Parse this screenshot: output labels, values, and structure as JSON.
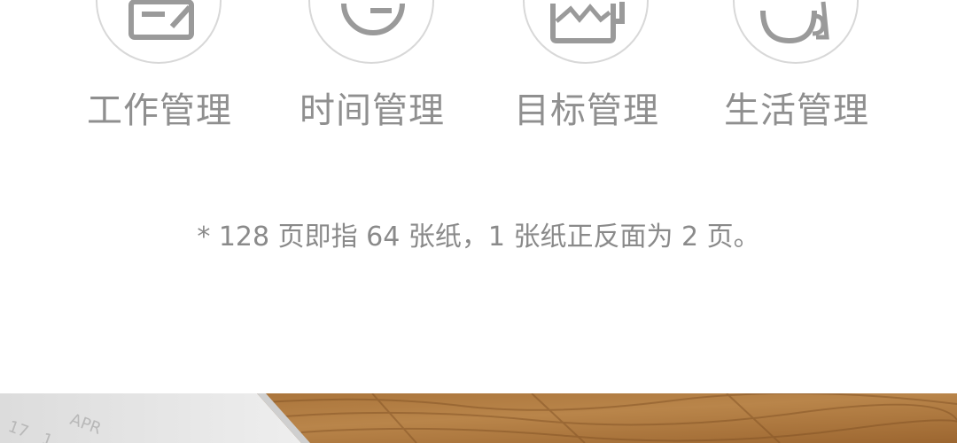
{
  "features": [
    {
      "label": "工作管理",
      "icon": "notebook-pen-icon"
    },
    {
      "label": "时间管理",
      "icon": "clock-icon"
    },
    {
      "label": "目标管理",
      "icon": "mountain-frame-icon"
    },
    {
      "label": "生活管理",
      "icon": "coffee-cup-icon"
    }
  ],
  "note": "* 128 页即指 64 张纸，1 张纸正反面为 2 页。",
  "photo": {
    "paper_text": [
      "APR",
      "17",
      "1"
    ]
  },
  "colors": {
    "text": "#8a8a8a",
    "icon_stroke": "#9a9a9a",
    "circle_border": "#d8d8d8",
    "wood": "#b07a3e"
  }
}
